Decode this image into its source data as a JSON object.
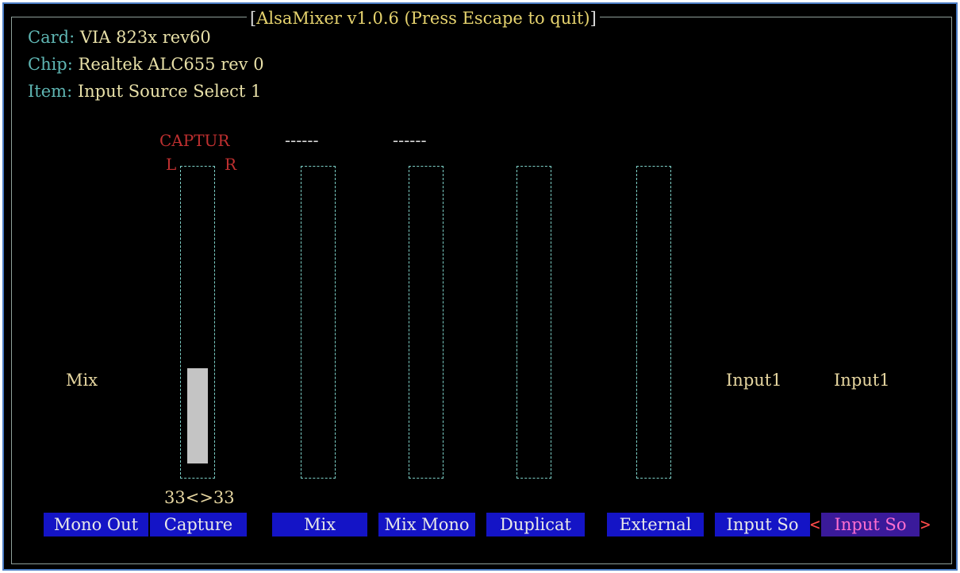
{
  "window": {
    "title_prefix": "[",
    "title": "AlsaMixer v1.0.6 (Press Escape to quit)",
    "title_suffix": "]"
  },
  "info": {
    "card_label": "Card: ",
    "card_value": "VIA 823x rev60",
    "chip_label": "Chip: ",
    "chip_value": "Realtek ALC655 rev 0",
    "item_label": "Item: ",
    "item_value": "Input Source Select 1"
  },
  "capture_flag": "CAPTUR",
  "left_marker": "L",
  "right_marker": "R",
  "dash_mix": "------",
  "dash_mixmono": "------",
  "mono_out_enum": "Mix",
  "input_enum_1": "Input1",
  "input_enum_2": "Input1",
  "capture_volume": "33<>33",
  "capture_level_percent": 33,
  "channels": [
    {
      "label": "Mono Out"
    },
    {
      "label": "Capture"
    },
    {
      "label": "Mix"
    },
    {
      "label": "Mix Mono"
    },
    {
      "label": "Duplicat"
    },
    {
      "label": "External"
    },
    {
      "label": "Input So"
    },
    {
      "label": "Input So"
    }
  ],
  "selected_left": "<",
  "selected_right": ">",
  "colors": {
    "background": "#000000",
    "label_cyan": "#5fb6b3",
    "value_cream": "#e8e0a8",
    "channel_bg": "#1414c6",
    "selected_text": "#ff6fd0",
    "capture_red": "#c03030",
    "meter_border": "#7ccfc6"
  }
}
